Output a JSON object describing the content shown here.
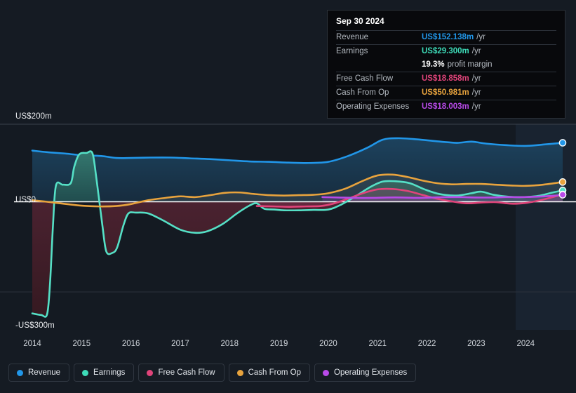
{
  "chart_data": {
    "type": "area",
    "title": "",
    "xlabel": "",
    "ylabel": "",
    "grid": true,
    "legend_position": "bottom",
    "ylim": [
      -300,
      200
    ],
    "y_ticks": [
      {
        "value": 200,
        "label": "US$200m"
      },
      {
        "value": 0,
        "label": "US$0"
      },
      {
        "value": -300,
        "label": "-US$300m"
      }
    ],
    "y_gridlines": [
      200,
      0,
      -150
    ],
    "x": [
      2014,
      2015,
      2016,
      2017,
      2018,
      2019,
      2020,
      2021,
      2022,
      2023,
      2024
    ],
    "x_tick_labels": [
      "2014",
      "2015",
      "2016",
      "2017",
      "2018",
      "2019",
      "2020",
      "2021",
      "2022",
      "2023",
      "2024"
    ],
    "series": [
      {
        "name": "Revenue",
        "color": "#2196e8",
        "fill": "#1b3a52",
        "points": [
          [
            2014.0,
            132
          ],
          [
            2014.3,
            128
          ],
          [
            2014.7,
            124
          ],
          [
            2015.0,
            120
          ],
          [
            2015.4,
            118
          ],
          [
            2015.7,
            113
          ],
          [
            2016.0,
            113
          ],
          [
            2016.4,
            114
          ],
          [
            2016.8,
            114
          ],
          [
            2017.2,
            112
          ],
          [
            2017.6,
            110
          ],
          [
            2018.0,
            107
          ],
          [
            2018.4,
            104
          ],
          [
            2018.8,
            103
          ],
          [
            2019.2,
            101
          ],
          [
            2019.6,
            100
          ],
          [
            2020.0,
            103
          ],
          [
            2020.4,
            118
          ],
          [
            2020.8,
            140
          ],
          [
            2021.1,
            160
          ],
          [
            2021.4,
            164
          ],
          [
            2021.8,
            161
          ],
          [
            2022.2,
            156
          ],
          [
            2022.6,
            152
          ],
          [
            2022.9,
            155
          ],
          [
            2023.2,
            150
          ],
          [
            2023.6,
            146
          ],
          [
            2024.0,
            144
          ],
          [
            2024.4,
            148
          ],
          [
            2024.75,
            152.138
          ]
        ],
        "end_value": 152.138
      },
      {
        "name": "Earnings",
        "color": "#55e0c6",
        "fill_positive": "#2c5f60",
        "fill_negative": "#3d2029",
        "points": [
          [
            2014.0,
            -288
          ],
          [
            2014.18,
            -292
          ],
          [
            2014.3,
            -290
          ],
          [
            2014.36,
            -210
          ],
          [
            2014.42,
            -60
          ],
          [
            2014.48,
            42
          ],
          [
            2014.62,
            44
          ],
          [
            2014.78,
            48
          ],
          [
            2014.85,
            90
          ],
          [
            2014.95,
            122
          ],
          [
            2015.1,
            126
          ],
          [
            2015.22,
            125
          ],
          [
            2015.3,
            60
          ],
          [
            2015.42,
            -60
          ],
          [
            2015.5,
            -128
          ],
          [
            2015.62,
            -132
          ],
          [
            2015.72,
            -118
          ],
          [
            2015.85,
            -60
          ],
          [
            2015.95,
            -30
          ],
          [
            2016.1,
            -28
          ],
          [
            2016.35,
            -30
          ],
          [
            2016.65,
            -48
          ],
          [
            2017.0,
            -72
          ],
          [
            2017.3,
            -80
          ],
          [
            2017.55,
            -76
          ],
          [
            2017.85,
            -58
          ],
          [
            2018.15,
            -30
          ],
          [
            2018.4,
            -10
          ],
          [
            2018.55,
            -4
          ],
          [
            2018.7,
            -18
          ],
          [
            2018.9,
            -20
          ],
          [
            2019.1,
            -22
          ],
          [
            2019.4,
            -22
          ],
          [
            2019.7,
            -21
          ],
          [
            2020.0,
            -20
          ],
          [
            2020.25,
            -8
          ],
          [
            2020.55,
            14
          ],
          [
            2020.85,
            38
          ],
          [
            2021.1,
            52
          ],
          [
            2021.35,
            53
          ],
          [
            2021.65,
            48
          ],
          [
            2021.95,
            32
          ],
          [
            2022.25,
            20
          ],
          [
            2022.6,
            16
          ],
          [
            2022.9,
            22
          ],
          [
            2023.1,
            26
          ],
          [
            2023.35,
            18
          ],
          [
            2023.65,
            13
          ],
          [
            2023.95,
            12
          ],
          [
            2024.25,
            15
          ],
          [
            2024.55,
            24
          ],
          [
            2024.75,
            29.3
          ]
        ],
        "end_value": 29.3
      },
      {
        "name": "Free Cash Flow",
        "color": "#e0447a",
        "fill": "#58283c",
        "start_x": 2018.55,
        "points": [
          [
            2018.55,
            -11
          ],
          [
            2018.9,
            -12
          ],
          [
            2019.2,
            -13
          ],
          [
            2019.55,
            -12
          ],
          [
            2019.85,
            -11
          ],
          [
            2020.1,
            -5
          ],
          [
            2020.4,
            8
          ],
          [
            2020.7,
            22
          ],
          [
            2021.0,
            32
          ],
          [
            2021.3,
            33
          ],
          [
            2021.6,
            28
          ],
          [
            2021.9,
            18
          ],
          [
            2022.2,
            8
          ],
          [
            2022.5,
            1
          ],
          [
            2022.8,
            -4
          ],
          [
            2023.1,
            -2
          ],
          [
            2023.4,
            -1
          ],
          [
            2023.7,
            -5
          ],
          [
            2024.0,
            -3
          ],
          [
            2024.3,
            4
          ],
          [
            2024.55,
            12
          ],
          [
            2024.75,
            18.858
          ]
        ],
        "end_value": 18.858
      },
      {
        "name": "Cash From Op",
        "color": "#e8a33d",
        "points": [
          [
            2014.0,
            4
          ],
          [
            2014.3,
            0
          ],
          [
            2014.7,
            -6
          ],
          [
            2015.0,
            -10
          ],
          [
            2015.35,
            -12
          ],
          [
            2015.7,
            -11
          ],
          [
            2016.0,
            -6
          ],
          [
            2016.35,
            4
          ],
          [
            2016.7,
            10
          ],
          [
            2017.0,
            14
          ],
          [
            2017.3,
            12
          ],
          [
            2017.6,
            17
          ],
          [
            2017.9,
            23
          ],
          [
            2018.2,
            24
          ],
          [
            2018.5,
            20
          ],
          [
            2018.8,
            17
          ],
          [
            2019.1,
            16
          ],
          [
            2019.4,
            17
          ],
          [
            2019.7,
            18
          ],
          [
            2020.0,
            22
          ],
          [
            2020.35,
            34
          ],
          [
            2020.7,
            54
          ],
          [
            2021.0,
            68
          ],
          [
            2021.3,
            70
          ],
          [
            2021.6,
            64
          ],
          [
            2021.9,
            55
          ],
          [
            2022.2,
            48
          ],
          [
            2022.5,
            45
          ],
          [
            2022.8,
            46
          ],
          [
            2023.1,
            46
          ],
          [
            2023.4,
            44
          ],
          [
            2023.7,
            42
          ],
          [
            2024.0,
            41
          ],
          [
            2024.35,
            44
          ],
          [
            2024.75,
            50.981
          ]
        ],
        "end_value": 50.981
      },
      {
        "name": "Operating Expenses",
        "color": "#b84ae8",
        "start_x": 2019.88,
        "points": [
          [
            2019.88,
            12
          ],
          [
            2020.2,
            11
          ],
          [
            2020.55,
            10
          ],
          [
            2020.9,
            10
          ],
          [
            2021.2,
            11
          ],
          [
            2021.5,
            11
          ],
          [
            2021.8,
            10
          ],
          [
            2022.1,
            11
          ],
          [
            2022.4,
            12
          ],
          [
            2022.7,
            12
          ],
          [
            2023.0,
            11
          ],
          [
            2023.3,
            11
          ],
          [
            2023.6,
            12
          ],
          [
            2023.9,
            12
          ],
          [
            2024.2,
            13
          ],
          [
            2024.5,
            15
          ],
          [
            2024.75,
            18.003
          ]
        ],
        "end_value": 18.003
      }
    ]
  },
  "tooltip": {
    "date": "Sep 30 2024",
    "rows": [
      {
        "label": "Revenue",
        "value": "US$152.138m",
        "unit": "/yr",
        "color": "#2196e8"
      },
      {
        "label": "Earnings",
        "value": "US$29.300m",
        "unit": "/yr",
        "color": "#3ddbb8"
      },
      {
        "label": "",
        "value": "19.3%",
        "unit": "profit margin",
        "color": "#ffffff"
      },
      {
        "label": "Free Cash Flow",
        "value": "US$18.858m",
        "unit": "/yr",
        "color": "#e0447a"
      },
      {
        "label": "Cash From Op",
        "value": "US$50.981m",
        "unit": "/yr",
        "color": "#e8a33d"
      },
      {
        "label": "Operating Expenses",
        "value": "US$18.003m",
        "unit": "/yr",
        "color": "#b84ae8"
      }
    ]
  },
  "legend": {
    "items": [
      {
        "label": "Revenue",
        "color": "#2196e8"
      },
      {
        "label": "Earnings",
        "color": "#3ddbb8"
      },
      {
        "label": "Free Cash Flow",
        "color": "#e0447a"
      },
      {
        "label": "Cash From Op",
        "color": "#e8a33d"
      },
      {
        "label": "Operating Expenses",
        "color": "#b84ae8"
      }
    ]
  },
  "axes": {
    "y_top_label": "US$200m",
    "y_zero_label": "US$0",
    "y_bottom_label": "-US$300m"
  }
}
